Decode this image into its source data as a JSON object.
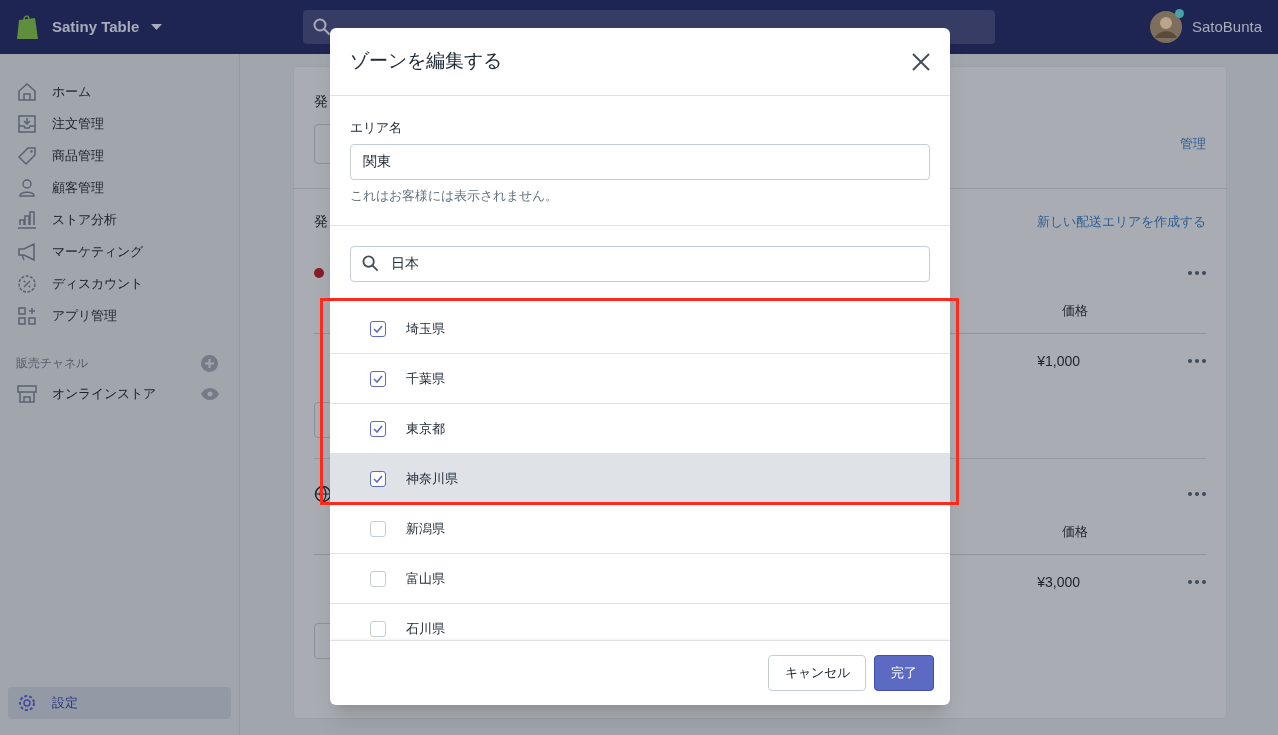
{
  "topbar": {
    "store_name": "Satiny Table",
    "user": "SatoBunta"
  },
  "sidebar": {
    "items": [
      {
        "label": "ホーム",
        "kind": "home",
        "selected": false
      },
      {
        "label": "注文管理",
        "kind": "inbox",
        "selected": false
      },
      {
        "label": "商品管理",
        "kind": "tag",
        "selected": false
      },
      {
        "label": "顧客管理",
        "kind": "person",
        "selected": false
      },
      {
        "label": "ストア分析",
        "kind": "chart",
        "selected": false
      },
      {
        "label": "マーケティング",
        "kind": "megaphone",
        "selected": false
      },
      {
        "label": "ディスカウント",
        "kind": "discount",
        "selected": false
      },
      {
        "label": "アプリ管理",
        "kind": "apps",
        "selected": false
      }
    ],
    "channels_heading": "販売チャネル",
    "channels": [
      {
        "label": "オンラインストア"
      }
    ],
    "settings": {
      "label": "設定",
      "selected": true
    }
  },
  "main": {
    "section_1": {
      "heading": "発",
      "link": "管理"
    },
    "section_2": {
      "heading": "発",
      "link": "新しい配送エリアを作成する",
      "zones": [
        {
          "kind": "dot",
          "column": "価格",
          "price": "¥1,000"
        },
        {
          "kind": "globe",
          "column": "価格",
          "price": "¥3,000"
        }
      ]
    }
  },
  "modal": {
    "title": "ゾーンを編集する",
    "name_label": "エリア名",
    "name_value": "関東",
    "name_help": "これはお客様には表示されません。",
    "search_value": "日本",
    "regions": [
      {
        "label": "埼玉県",
        "checked": true,
        "selected": false
      },
      {
        "label": "千葉県",
        "checked": true,
        "selected": false
      },
      {
        "label": "東京都",
        "checked": true,
        "selected": false
      },
      {
        "label": "神奈川県",
        "checked": true,
        "selected": true
      },
      {
        "label": "新潟県",
        "checked": false,
        "selected": false
      },
      {
        "label": "富山県",
        "checked": false,
        "selected": false
      },
      {
        "label": "石川県",
        "checked": false,
        "selected": false
      }
    ],
    "buttons": [
      {
        "label": "キャンセル",
        "kind": "secondary"
      },
      {
        "label": "完了",
        "kind": "primary"
      }
    ]
  }
}
